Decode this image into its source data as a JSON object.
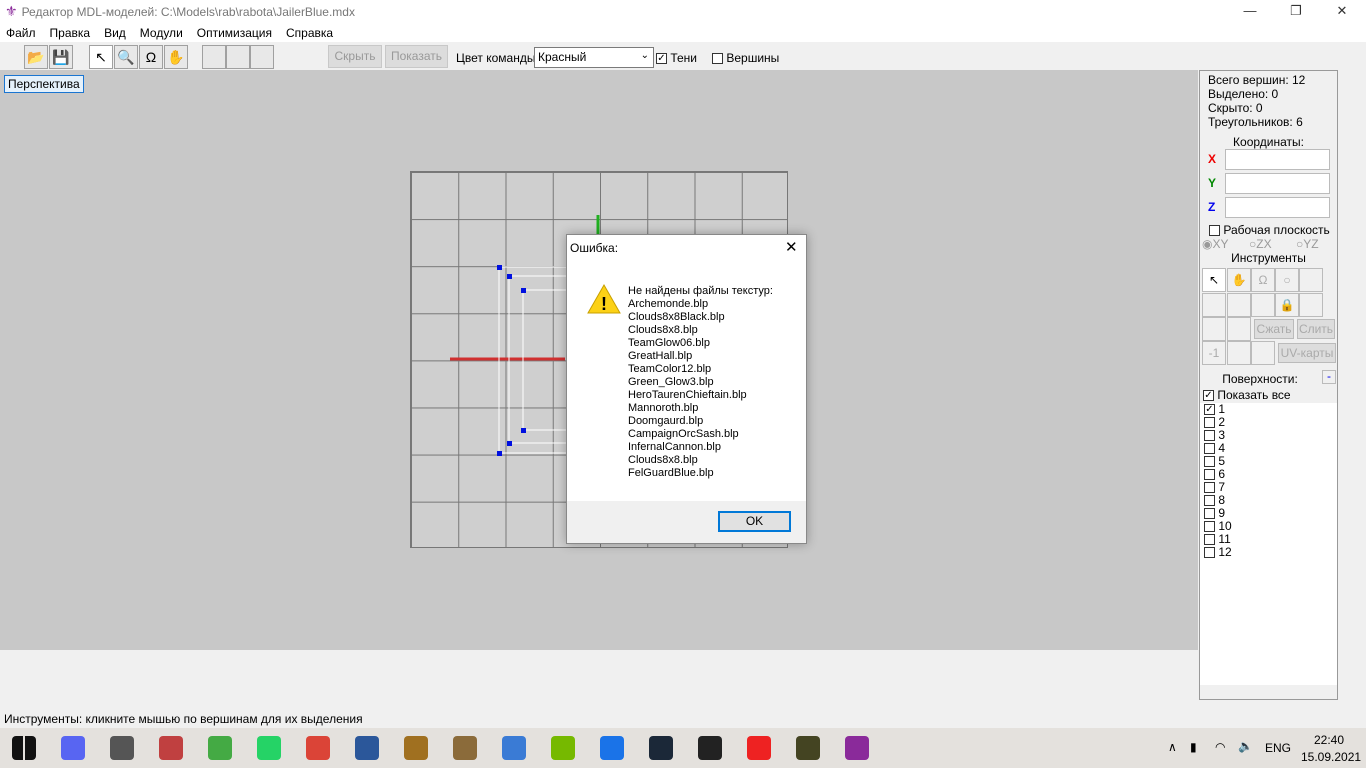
{
  "window": {
    "title": "Редактор MDL-моделей: C:\\Models\\rab\\rabota\\JailerBlue.mdx",
    "min": "—",
    "max": "❐",
    "close": "✕"
  },
  "menu": [
    "Файл",
    "Правка",
    "Вид",
    "Модули",
    "Оптимизация",
    "Справка"
  ],
  "toolbar": {
    "hide": "Скрыть",
    "show": "Показать",
    "team_color_label": "Цвет команды:",
    "team_color_value": "Красный",
    "shadows": "Тени",
    "vertices": "Вершины"
  },
  "viewport": {
    "label": "Перспектива"
  },
  "dialog": {
    "title": "Ошибка:",
    "message": "Не найдены файлы текстур:",
    "files": [
      "Archemonde.blp",
      "Clouds8x8Black.blp",
      "Clouds8x8.blp",
      "TeamGlow06.blp",
      "GreatHall.blp",
      "TeamColor12.blp",
      "Green_Glow3.blp",
      "HeroTaurenChieftain.blp",
      "Mannoroth.blp",
      "Doomgaurd.blp",
      "CampaignOrcSash.blp",
      "InfernalCannon.blp",
      "Clouds8x8.blp",
      "FelGuardBlue.blp"
    ],
    "ok": "OK"
  },
  "panel": {
    "stats": [
      "Всего вершин: 12",
      "Выделено: 0",
      "Скрыто: 0",
      "Треугольников: 6"
    ],
    "coords_title": "Координаты:",
    "x": "X",
    "y": "Y",
    "z": "Z",
    "work_plane": "Рабочая плоскость",
    "planes": [
      "XY",
      "ZX",
      "YZ"
    ],
    "tools_title": "Инструменты",
    "compress": "Сжать",
    "merge": "Слить",
    "minus_one": "-1",
    "uv": "UV-карты",
    "surfaces_title": "Поверхности:",
    "collapse": "-",
    "show_all": "Показать все",
    "surfaces": [
      "1",
      "2",
      "3",
      "4",
      "5",
      "6",
      "7",
      "8",
      "9",
      "10",
      "11",
      "12"
    ]
  },
  "status": "Инструменты: кликните мышью по вершинам для их выделения",
  "tray": {
    "lang": "ENG",
    "time": "22:40",
    "date": "15.09.2021"
  },
  "taskbar_icons": [
    "windows-start",
    "discord",
    "window-app",
    "blocks",
    "green-cube",
    "whatsapp",
    "chrome",
    "word",
    "warcraft",
    "scroll",
    "blue-window",
    "nvidia",
    "bluetooth-app",
    "steam",
    "terminal",
    "yandex",
    "warcraft-hero",
    "mdl-editor"
  ]
}
